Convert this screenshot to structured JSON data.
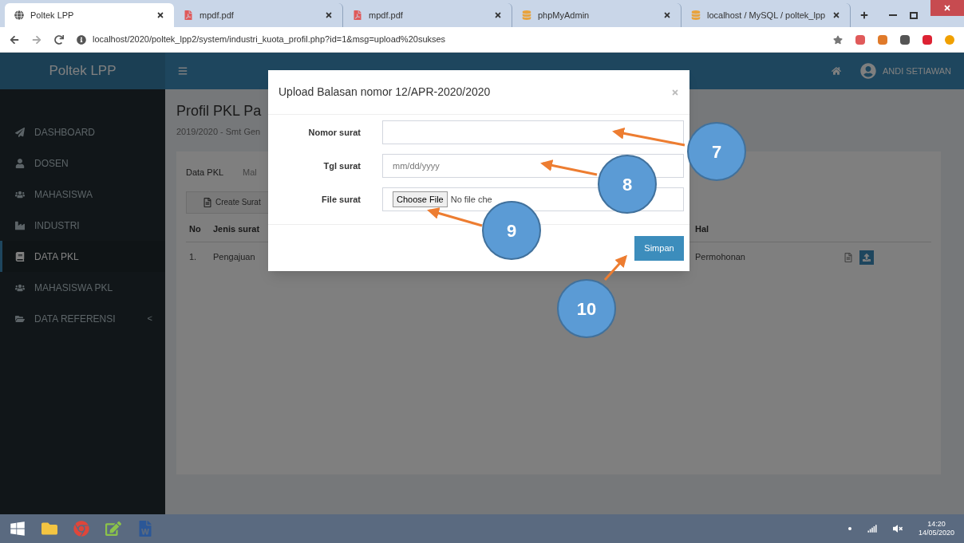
{
  "browser": {
    "tabs": [
      {
        "title": "Poltek LPP",
        "selected": true,
        "kind": "globe"
      },
      {
        "title": "mpdf.pdf",
        "selected": false,
        "kind": "pdf"
      },
      {
        "title": "mpdf.pdf",
        "selected": false,
        "kind": "pdf"
      },
      {
        "title": "phpMyAdmin",
        "selected": false,
        "kind": "pma"
      },
      {
        "title": "localhost / MySQL / poltek_lpp",
        "selected": false,
        "kind": "pma"
      }
    ],
    "url": "localhost/2020/poltek_lpp2/system/industri_kuota_profil.php?id=1&msg=upload%20sukses"
  },
  "app": {
    "brand": "Poltek LPP",
    "user": "ANDI SETIAWAN",
    "sidebar": [
      {
        "label": "DASHBOARD",
        "selected": false,
        "kind": "send"
      },
      {
        "label": "DOSEN",
        "selected": false,
        "kind": "user"
      },
      {
        "label": "MAHASISWA",
        "selected": false,
        "kind": "users"
      },
      {
        "label": "INDUSTRI",
        "selected": false,
        "kind": "industry"
      },
      {
        "label": "DATA PKL",
        "selected": true,
        "kind": "book"
      },
      {
        "label": "MAHASISWA PKL",
        "selected": false,
        "kind": "users"
      },
      {
        "label": "DATA REFERENSI",
        "selected": false,
        "kind": "folder",
        "caret": "<"
      }
    ],
    "page_title": "Profil PKL Pa",
    "subtitle": "2019/2020 - Smt Gen",
    "tabs": [
      {
        "label": "Data PKL",
        "selected": true
      },
      {
        "label": "Mal",
        "selected": false
      }
    ],
    "create_button": "Create Surat",
    "table": {
      "columns": [
        "No",
        "Jenis surat",
        "Hal"
      ],
      "rows": [
        {
          "no": "1.",
          "jenis": "Pengajuan",
          "hal": "Permohonan"
        }
      ]
    }
  },
  "modal": {
    "title": "Upload Balasan nomor 12/APR-2020/2020",
    "fields": [
      {
        "label": "Nomor surat",
        "kind": "text"
      },
      {
        "label": "Tgl surat",
        "kind": "date",
        "placeholder": "mm/dd/yyyy"
      },
      {
        "label": "File surat",
        "kind": "file",
        "button": "Choose File",
        "value": "No file che"
      }
    ],
    "submit": "Simpan"
  },
  "annotations": [
    {
      "label": "7"
    },
    {
      "label": "8"
    },
    {
      "label": "9"
    },
    {
      "label": "10"
    }
  ],
  "taskbar": {
    "time": "14:20",
    "date": "14/05/2020"
  }
}
